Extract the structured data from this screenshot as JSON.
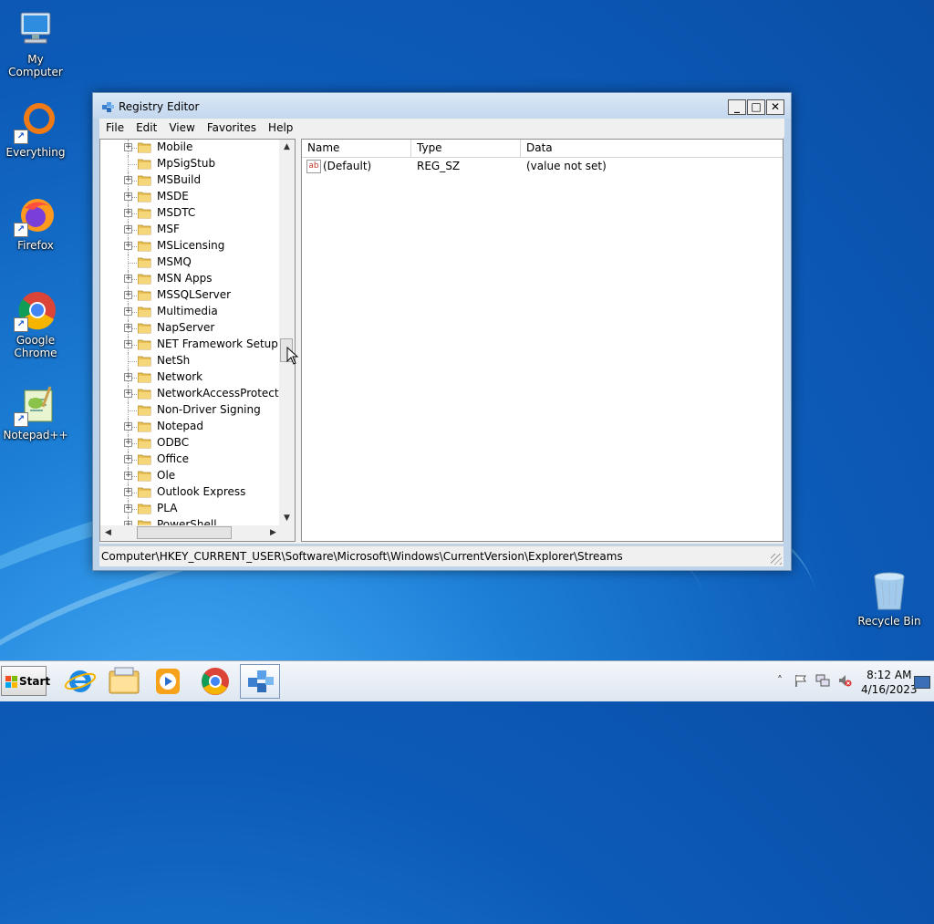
{
  "desktop": {
    "icons": [
      {
        "label": "My Computer",
        "icon": "computer-icon"
      },
      {
        "label": "Everything",
        "icon": "everything-icon"
      },
      {
        "label": "Firefox",
        "icon": "firefox-icon"
      },
      {
        "label": "Google Chrome",
        "icon": "chrome-icon"
      },
      {
        "label": "Notepad++",
        "icon": "notepadpp-icon"
      },
      {
        "label": "Recycle Bin",
        "icon": "recycle-bin-icon"
      }
    ]
  },
  "window": {
    "title": "Registry Editor",
    "controls": {
      "minimize": "_",
      "maximize": "□",
      "close": "✕"
    },
    "menu": [
      "File",
      "Edit",
      "View",
      "Favorites",
      "Help"
    ],
    "tree": [
      {
        "label": "Mobile",
        "expandable": true
      },
      {
        "label": "MpSigStub",
        "expandable": false
      },
      {
        "label": "MSBuild",
        "expandable": true
      },
      {
        "label": "MSDE",
        "expandable": true
      },
      {
        "label": "MSDTC",
        "expandable": true
      },
      {
        "label": "MSF",
        "expandable": true
      },
      {
        "label": "MSLicensing",
        "expandable": true
      },
      {
        "label": "MSMQ",
        "expandable": false
      },
      {
        "label": "MSN Apps",
        "expandable": true
      },
      {
        "label": "MSSQLServer",
        "expandable": true
      },
      {
        "label": "Multimedia",
        "expandable": true
      },
      {
        "label": "NapServer",
        "expandable": true
      },
      {
        "label": "NET Framework Setup",
        "expandable": true
      },
      {
        "label": "NetSh",
        "expandable": false
      },
      {
        "label": "Network",
        "expandable": true
      },
      {
        "label": "NetworkAccessProtection",
        "expandable": true
      },
      {
        "label": "Non-Driver Signing",
        "expandable": false
      },
      {
        "label": "Notepad",
        "expandable": true
      },
      {
        "label": "ODBC",
        "expandable": true
      },
      {
        "label": "Office",
        "expandable": true
      },
      {
        "label": "Ole",
        "expandable": true
      },
      {
        "label": "Outlook Express",
        "expandable": true
      },
      {
        "label": "PLA",
        "expandable": true
      },
      {
        "label": "PowerShell",
        "expandable": true
      }
    ],
    "list": {
      "columns": [
        "Name",
        "Type",
        "Data"
      ],
      "rows": [
        {
          "name": "(Default)",
          "type": "REG_SZ",
          "data": "(value not set)",
          "icon": "ab"
        }
      ]
    },
    "status_path": "Computer\\HKEY_CURRENT_USER\\Software\\Microsoft\\Windows\\CurrentVersion\\Explorer\\Streams"
  },
  "taskbar": {
    "start_label": "Start",
    "pinned": [
      "internet-explorer-icon",
      "windows-explorer-icon",
      "media-player-icon",
      "chrome-icon",
      "regedit-icon"
    ],
    "tray_expand": "˄",
    "clock_time": "8:12 AM",
    "clock_date": "4/16/2023"
  }
}
